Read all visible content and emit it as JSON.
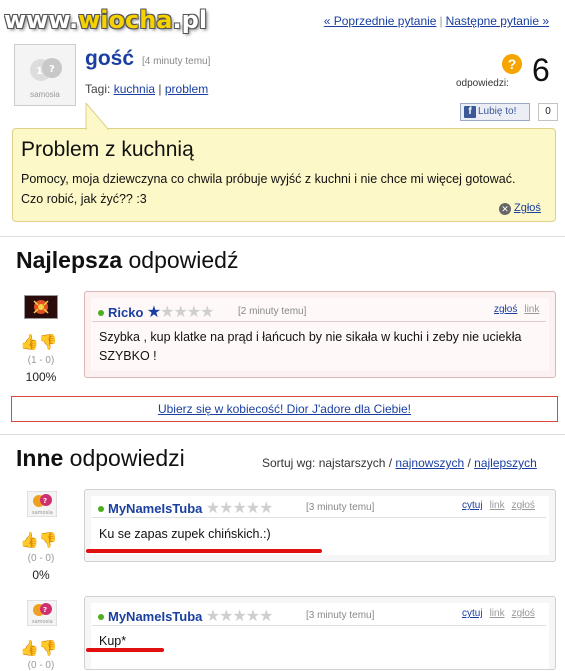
{
  "watermark": {
    "prefix": "www.",
    "accent": "wiocha",
    "suffix": ".pl"
  },
  "topnav": {
    "prev": "« Poprzednie pytanie",
    "next": "Następne pytanie »"
  },
  "asker": {
    "name": "gość",
    "time": "[4 minuty temu]",
    "tags_label": "Tagi:",
    "tags": [
      "kuchnia",
      "problem"
    ],
    "avatar_brand": "samosia"
  },
  "answers_count": {
    "label": "odpowiedzi:",
    "value": "6"
  },
  "facebook": {
    "like_label": "Lubię to!",
    "count": "0"
  },
  "question": {
    "title": "Problem z kuchnią",
    "body": "Pomocy, moja dziewczyna co chwila próbuje wyjść z kuchni i nie chce mi więcej gotować. Czo robić, jak żyć?? :3",
    "report_label": "Zgłoś"
  },
  "best": {
    "heading_bold": "Najlepsza",
    "heading_rest": " odpowiedź",
    "author": "Ricko",
    "stars_filled": 1,
    "stars_total": 5,
    "time": "[2 minuty temu]",
    "report": "zgłoś",
    "link": "link",
    "text": "Szybka , kup klatke na prąd i łańcuch by nie sikała w kuchi i zeby nie uciekła SZYBKO !",
    "votes": "(1 - 0)",
    "pct": "100%"
  },
  "ad": {
    "text": "Ubierz się w kobiecość! Dior J'adore dla Ciebie!"
  },
  "others": {
    "heading_bold": "Inne",
    "heading_rest": " odpowiedzi",
    "sort_label": "Sortuj wg:",
    "sort_current": "najstarszych",
    "sort_newest": "najnowszych",
    "sort_best": "najlepszych",
    "items": [
      {
        "author": "MyNameIsTuba",
        "time": "[3 minuty temu]",
        "quote": "cytuj",
        "link": "link",
        "report": "zgłoś",
        "text": "Ku se zapas zupek chińskich.:)",
        "votes": "(0 - 0)",
        "pct": "0%",
        "avatar_brand": "samosia"
      },
      {
        "author": "MyNameIsTuba",
        "time": "[3 minuty temu]",
        "quote": "cytuj",
        "link": "link",
        "report": "zgłoś",
        "text": "Kup*",
        "votes": "(0 - 0)",
        "pct": "",
        "avatar_brand": "samosia"
      }
    ]
  },
  "colors": {
    "link": "#1a3fa0",
    "question_bg": "#fdf8c8",
    "highlight_red": "#e01010",
    "orange_badge": "#f5a400"
  }
}
